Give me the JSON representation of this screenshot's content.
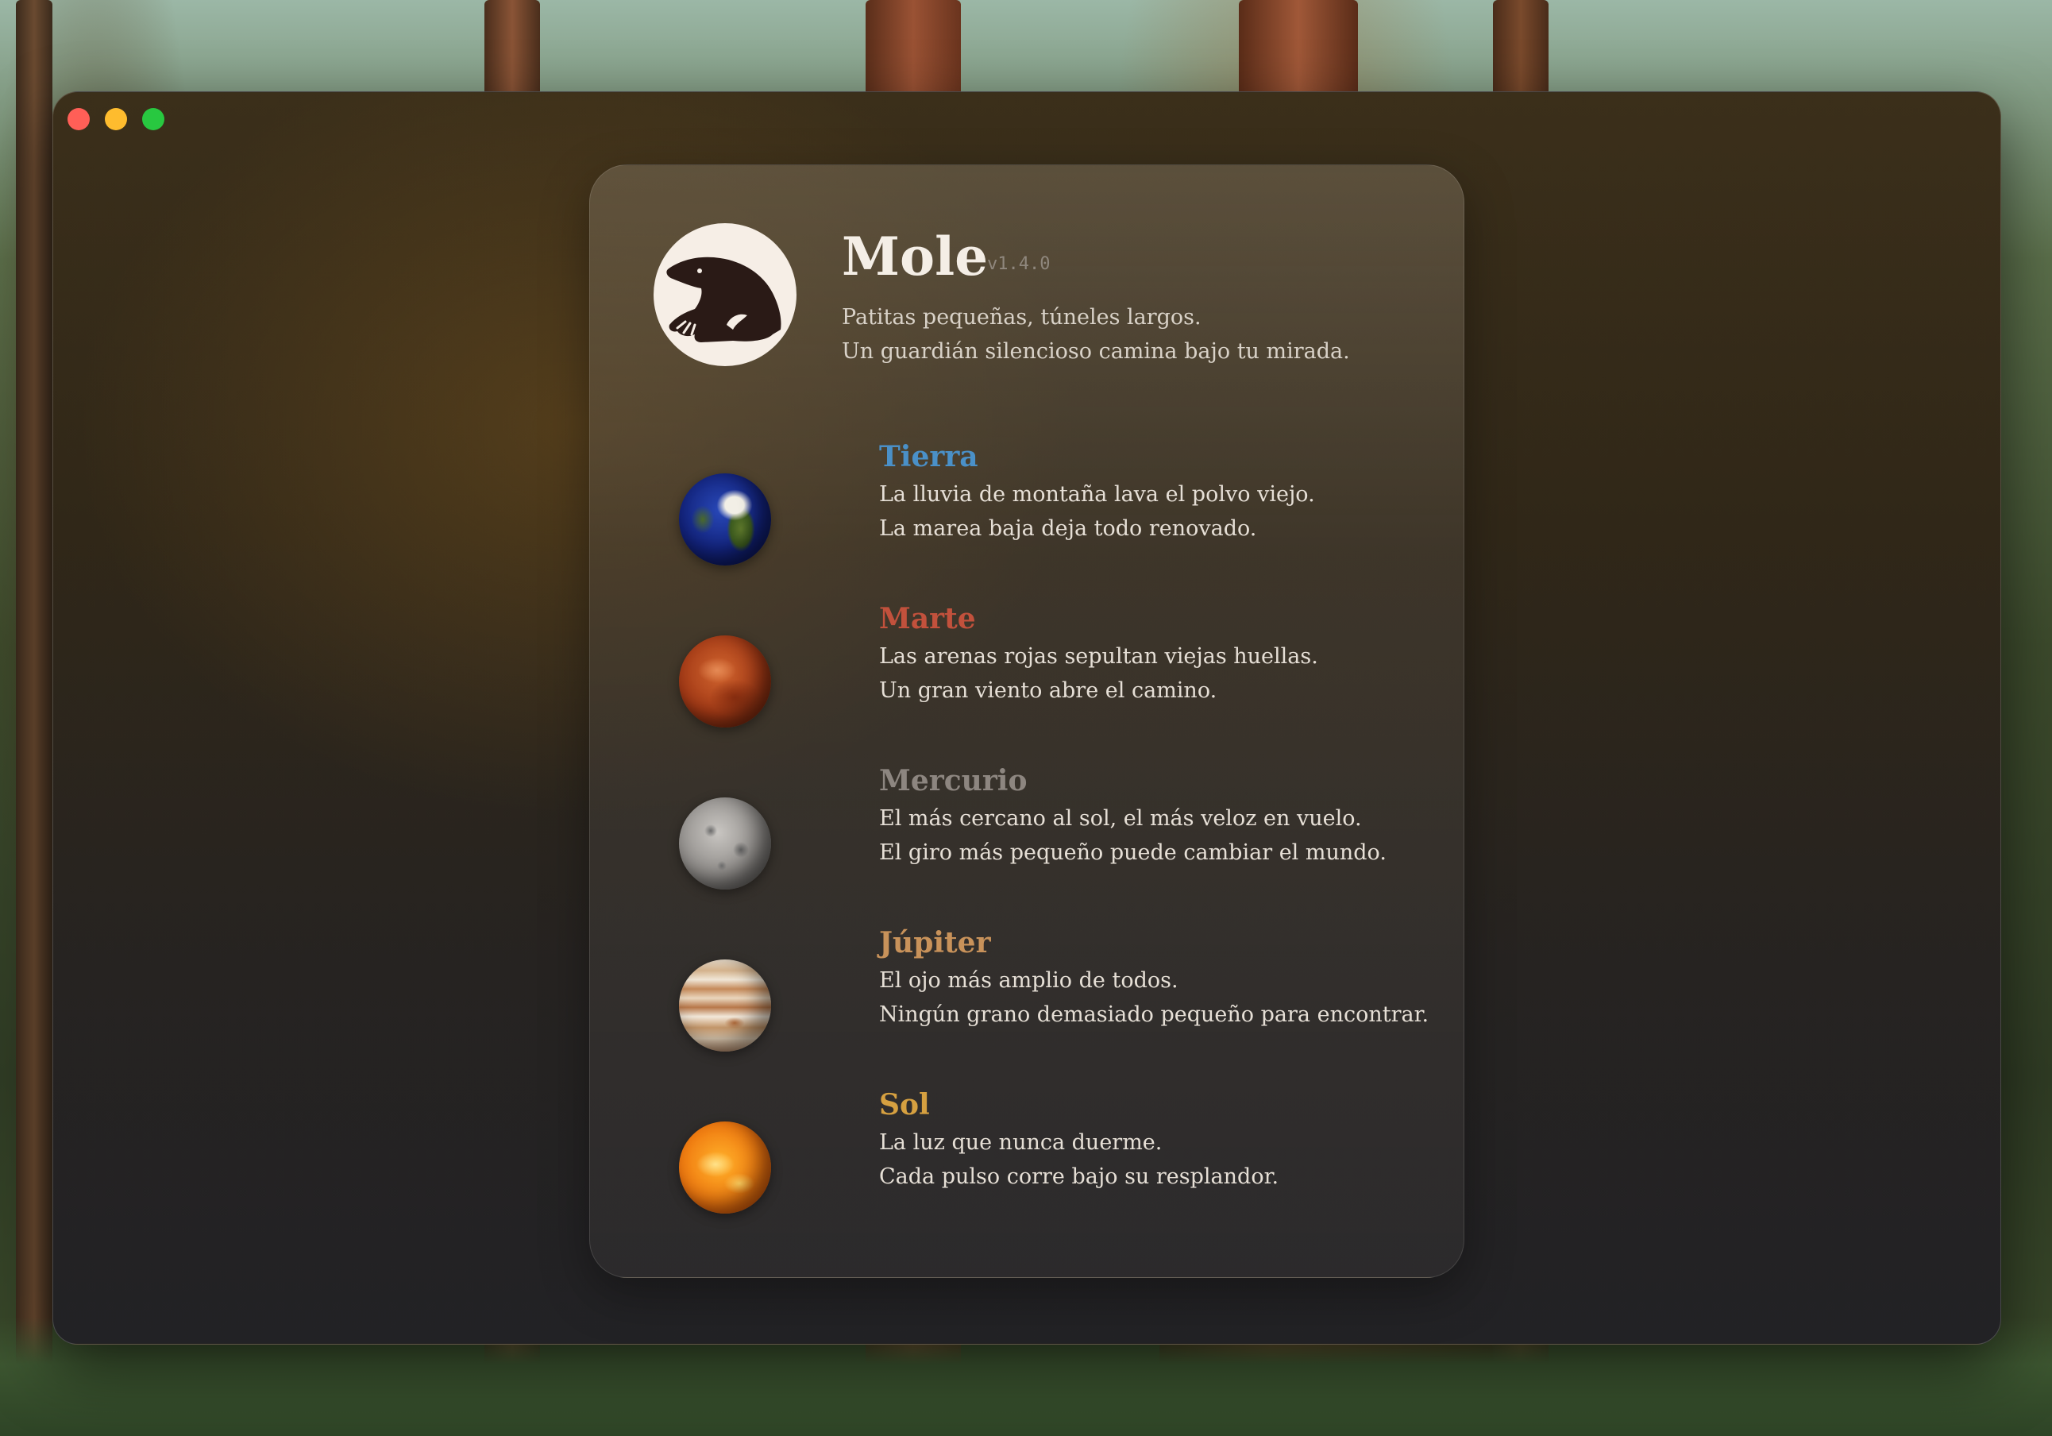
{
  "app": {
    "name": "Mole",
    "version": "v1.4.0",
    "tagline_1": "Patitas pequeñas, túneles largos.",
    "tagline_2": "Un guardián silencioso camina bajo tu mirada."
  },
  "planets": [
    {
      "icon": "earth-icon",
      "name": "Tierra",
      "color": "#4a90c8",
      "line_1": "La lluvia de montaña lava el polvo viejo.",
      "line_2": "La marea baja deja todo renovado."
    },
    {
      "icon": "mars-icon",
      "name": "Marte",
      "color": "#c2513c",
      "line_1": "Las arenas rojas sepultan viejas huellas.",
      "line_2": "Un gran viento abre el camino."
    },
    {
      "icon": "mercury-icon",
      "name": "Mercurio",
      "color": "#8d8680",
      "line_1": "El más cercano al sol, el más veloz en vuelo.",
      "line_2": "El giro más pequeño puede cambiar el mundo."
    },
    {
      "icon": "jupiter-icon",
      "name": "Júpiter",
      "color": "#c8925a",
      "line_1": "El ojo más amplio de todos.",
      "line_2": "Ningún grano demasiado pequeño para encontrar."
    },
    {
      "icon": "sun-icon",
      "name": "Sol",
      "color": "#d6a040",
      "line_1": "La luz que nunca duerme.",
      "line_2": "Cada pulso corre bajo su resplandor."
    }
  ]
}
